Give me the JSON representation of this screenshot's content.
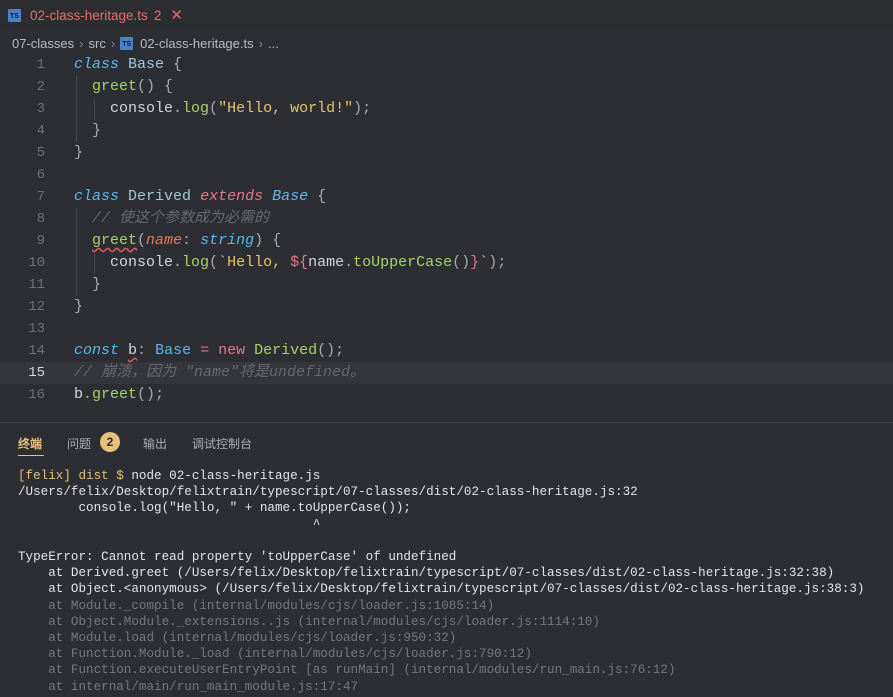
{
  "tab": {
    "icon": "TS",
    "file_name": "02-class-heritage.ts",
    "problem_count": "2",
    "close": "✕"
  },
  "breadcrumb": {
    "items": [
      "07-classes",
      "src",
      "02-class-heritage.ts",
      "..."
    ],
    "separator": "›"
  },
  "editor": {
    "line_numbers": [
      "1",
      "2",
      "3",
      "4",
      "5",
      "6",
      "7",
      "8",
      "9",
      "10",
      "11",
      "12",
      "13",
      "14",
      "15",
      "16"
    ],
    "active_line": 15,
    "lines": [
      [
        [
          "kw",
          "class"
        ],
        [
          "plain",
          " "
        ],
        [
          "cls",
          "Base"
        ],
        [
          "plain",
          " "
        ],
        [
          "punc",
          "{"
        ]
      ],
      [
        [
          "fn",
          "greet"
        ],
        [
          "punc",
          "() {"
        ]
      ],
      [
        [
          "plain",
          "console"
        ],
        [
          "punc",
          "."
        ],
        [
          "fn",
          "log"
        ],
        [
          "punc",
          "("
        ],
        [
          "str",
          "\"Hello, world!\""
        ],
        [
          "punc",
          ");"
        ]
      ],
      [
        [
          "punc",
          "}"
        ]
      ],
      [
        [
          "punc",
          "}"
        ]
      ],
      [],
      [
        [
          "kw",
          "class"
        ],
        [
          "plain",
          " "
        ],
        [
          "cls",
          "Derived"
        ],
        [
          "plain",
          " "
        ],
        [
          "kw2",
          "extends"
        ],
        [
          "plain",
          " "
        ],
        [
          "typ",
          "Base"
        ],
        [
          "plain",
          " "
        ],
        [
          "punc",
          "{"
        ]
      ],
      [
        [
          "cmt",
          "// 使这个参数成为必需的"
        ]
      ],
      [
        [
          "fn squig",
          "greet"
        ],
        [
          "punc",
          "("
        ],
        [
          "par",
          "name"
        ],
        [
          "punc",
          ": "
        ],
        [
          "typ",
          "string"
        ],
        [
          "punc",
          ") {"
        ]
      ],
      [
        [
          "plain",
          "console"
        ],
        [
          "punc",
          "."
        ],
        [
          "fn",
          "log"
        ],
        [
          "punc",
          "("
        ],
        [
          "str",
          "`Hello, "
        ],
        [
          "kwb",
          "${"
        ],
        [
          "plain",
          "name"
        ],
        [
          "punc",
          "."
        ],
        [
          "fn",
          "toUpperCase"
        ],
        [
          "punc",
          "()"
        ],
        [
          "kwb",
          "}"
        ],
        [
          "str",
          "`"
        ],
        [
          "punc",
          ");"
        ]
      ],
      [
        [
          "punc",
          "}"
        ]
      ],
      [
        [
          "punc",
          "}"
        ]
      ],
      [],
      [
        [
          "kw",
          "const"
        ],
        [
          "plain",
          " "
        ],
        [
          "plain squig",
          "b"
        ],
        [
          "punc",
          ": "
        ],
        [
          "cls2",
          "Base"
        ],
        [
          "plain",
          " "
        ],
        [
          "kwb",
          "="
        ],
        [
          "plain",
          " "
        ],
        [
          "kwb",
          "new"
        ],
        [
          "plain",
          " "
        ],
        [
          "fn",
          "Derived"
        ],
        [
          "punc",
          "();"
        ]
      ],
      [
        [
          "cmt",
          "// 崩溃，因为 \"name\"将是undefined。"
        ]
      ],
      [
        [
          "plain",
          "b"
        ],
        [
          "punc",
          "."
        ],
        [
          "fn",
          "greet"
        ],
        [
          "punc",
          "();"
        ]
      ]
    ]
  },
  "panel": {
    "tabs": [
      "终端",
      "问题",
      "输出",
      "调试控制台"
    ],
    "problems_badge": "2",
    "terminal_lines": [
      {
        "style": "mixed",
        "prompt": "[felix] dist $",
        "text": " node 02-class-heritage.js"
      },
      {
        "style": "normal",
        "text": "/Users/felix/Desktop/felixtrain/typescript/07-classes/dist/02-class-heritage.js:32"
      },
      {
        "style": "normal",
        "text": "        console.log(\"Hello, \" + name.toUpperCase());"
      },
      {
        "style": "normal",
        "text": "                                       ^"
      },
      {
        "style": "normal",
        "text": ""
      },
      {
        "style": "normal",
        "text": "TypeError: Cannot read property 'toUpperCase' of undefined"
      },
      {
        "style": "normal",
        "text": "    at Derived.greet (/Users/felix/Desktop/felixtrain/typescript/07-classes/dist/02-class-heritage.js:32:38)"
      },
      {
        "style": "normal",
        "text": "    at Object.<anonymous> (/Users/felix/Desktop/felixtrain/typescript/07-classes/dist/02-class-heritage.js:38:3)"
      },
      {
        "style": "dim",
        "text": "    at Module._compile (internal/modules/cjs/loader.js:1085:14)"
      },
      {
        "style": "dim",
        "text": "    at Object.Module._extensions..js (internal/modules/cjs/loader.js:1114:10)"
      },
      {
        "style": "dim",
        "text": "    at Module.load (internal/modules/cjs/loader.js:950:32)"
      },
      {
        "style": "dim",
        "text": "    at Function.Module._load (internal/modules/cjs/loader.js:790:12)"
      },
      {
        "style": "dim",
        "text": "    at Function.executeUserEntryPoint [as runMain] (internal/modules/run_main.js:76:12)"
      },
      {
        "style": "dim",
        "text": "    at internal/main/run_main_module.js:17:47"
      }
    ]
  }
}
